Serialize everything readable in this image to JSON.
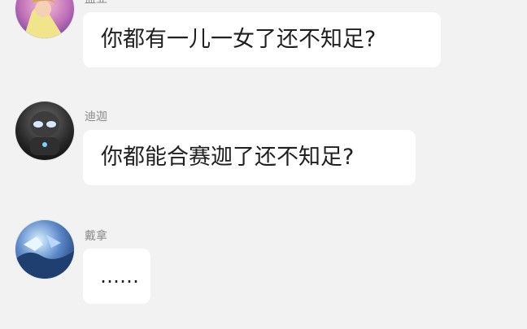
{
  "messages": [
    {
      "sender": "盖亚",
      "text": "你都有一儿一女了还不知足?",
      "avatar_icon": "gaia-avatar-icon"
    },
    {
      "sender": "迪迦",
      "text": "你都能合赛迦了还不知足?",
      "avatar_icon": "tiga-avatar-icon"
    },
    {
      "sender": "戴拿",
      "text": "……",
      "avatar_icon": "dyna-avatar-icon"
    }
  ]
}
